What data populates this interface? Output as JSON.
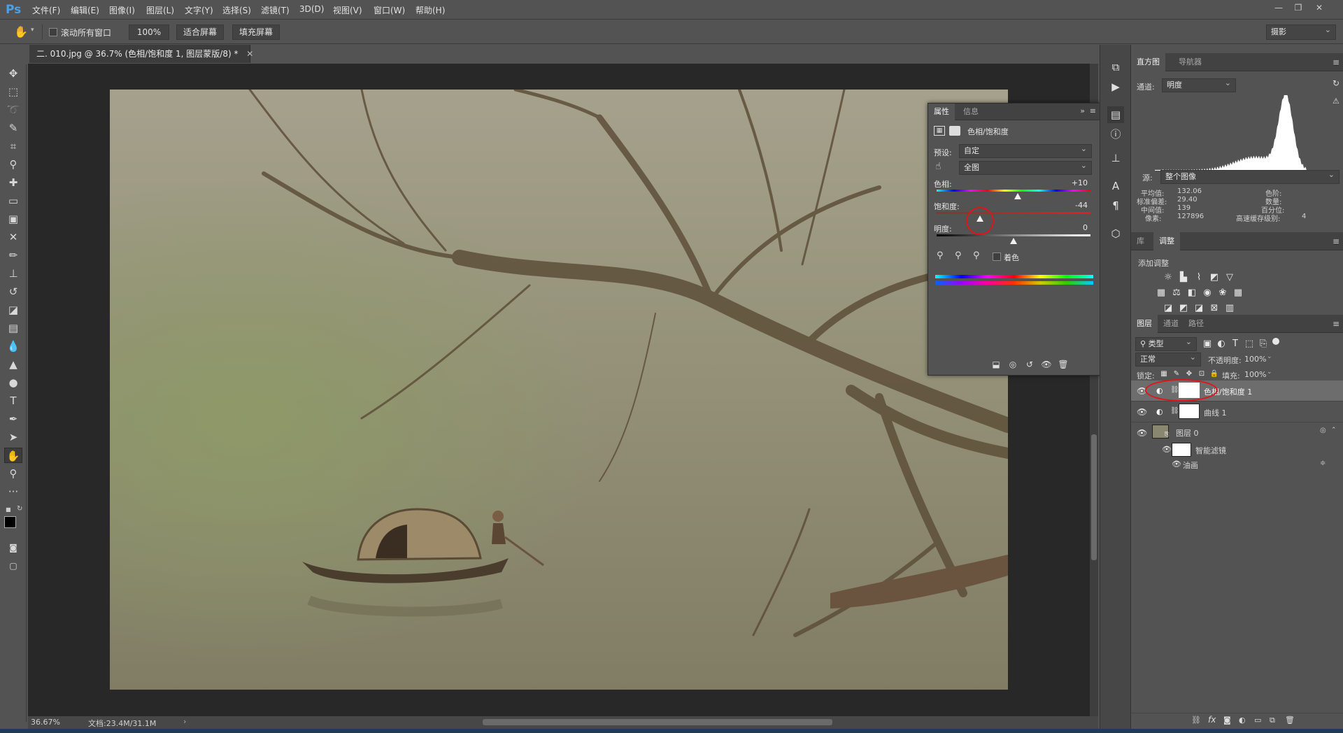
{
  "app": {
    "logo": "Ps"
  },
  "menu": [
    "文件(F)",
    "编辑(E)",
    "图像(I)",
    "图层(L)",
    "文字(Y)",
    "选择(S)",
    "滤镜(T)",
    "3D(D)",
    "视图(V)",
    "窗口(W)",
    "帮助(H)"
  ],
  "options": {
    "scroll_all_label": "滚动所有窗口",
    "zoom_value": "100%",
    "fit_screen": "适合屏幕",
    "fill_screen": "填充屏幕",
    "workspace": "摄影"
  },
  "document": {
    "tab_title": "二. 010.jpg @ 36.7% (色相/饱和度 1, 图层蒙版/8) *",
    "zoom": "36.67%",
    "doc_size": "文档:23.4M/31.1M"
  },
  "properties": {
    "tabs": [
      "属性",
      "信息"
    ],
    "header": "色相/饱和度",
    "preset_label": "预设:",
    "preset_value": "自定",
    "range_value": "全图",
    "hue_label": "色相:",
    "hue_value": "+10",
    "hue": 10,
    "saturation_label": "饱和度:",
    "saturation_value": "-44",
    "saturation": -44,
    "lightness_label": "明度:",
    "lightness_value": "0",
    "lightness": 0,
    "colorize_label": "着色"
  },
  "histogram": {
    "tabs": [
      "直方图",
      "导航器"
    ],
    "channel_label": "通道:",
    "channel_value": "明度",
    "source_label": "源:",
    "source_value": "整个图像",
    "stats": [
      {
        "label": "平均值:",
        "value": "132.06"
      },
      {
        "label": "标准偏差:",
        "value": "29.40"
      },
      {
        "label": "中间值:",
        "value": "139"
      },
      {
        "label": "像素:",
        "value": "127896"
      }
    ],
    "stats_right": [
      {
        "label": "色阶:",
        "value": ""
      },
      {
        "label": "数量:",
        "value": ""
      },
      {
        "label": "百分位:",
        "value": ""
      },
      {
        "label": "高速缓存级别:",
        "value": "4"
      }
    ]
  },
  "adjustments": {
    "tabs": [
      "库",
      "调整"
    ],
    "add_label": "添加调整"
  },
  "layers": {
    "tabs": [
      "图层",
      "通道",
      "路径"
    ],
    "filter_kind": "类型",
    "blend_mode": "正常",
    "opacity_label": "不透明度:",
    "opacity_value": "100%",
    "lock_label": "锁定:",
    "fill_label": "填充:",
    "fill_value": "100%",
    "items": [
      {
        "name": "色相/饱和度 1"
      },
      {
        "name": "曲线 1"
      },
      {
        "name": "图层 0"
      },
      {
        "name": "智能滤镜"
      },
      {
        "name": "油画"
      }
    ]
  },
  "colors": {
    "accent": "#4ea0e4",
    "annotation": "#e0141a",
    "panel": "#535353",
    "canvas": "#282828"
  }
}
